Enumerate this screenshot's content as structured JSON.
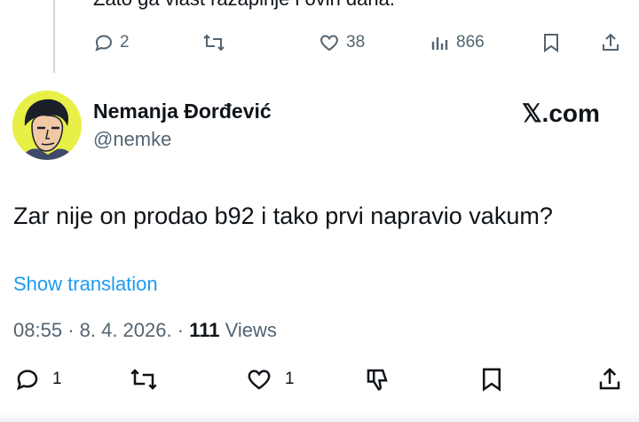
{
  "parent_tweet": {
    "text": "Zato ga vlast razapinje i ovih dana.",
    "replies": "2",
    "likes": "38",
    "views": "866"
  },
  "tweet": {
    "author_name": "Nemanja Đorđević",
    "handle": "@nemke",
    "brand": "𝕏.com",
    "text": "Zar nije on prodao b92 i tako prvi napravio vakum?",
    "show_translation": "Show translation",
    "time": "08:55",
    "date": "8. 4. 2026.",
    "views_count": "111",
    "views_label": "Views",
    "replies": "1",
    "likes": "1"
  },
  "icons": {
    "reply": "reply-icon",
    "retweet": "retweet-icon",
    "like": "like-icon",
    "views": "views-icon",
    "bookmark": "bookmark-icon",
    "share": "share-icon",
    "downvote": "downvote-icon"
  },
  "colors": {
    "text": "#0f1419",
    "secondary": "#536471",
    "link": "#1d9bf0",
    "avatar_bg": "#e8f048"
  }
}
